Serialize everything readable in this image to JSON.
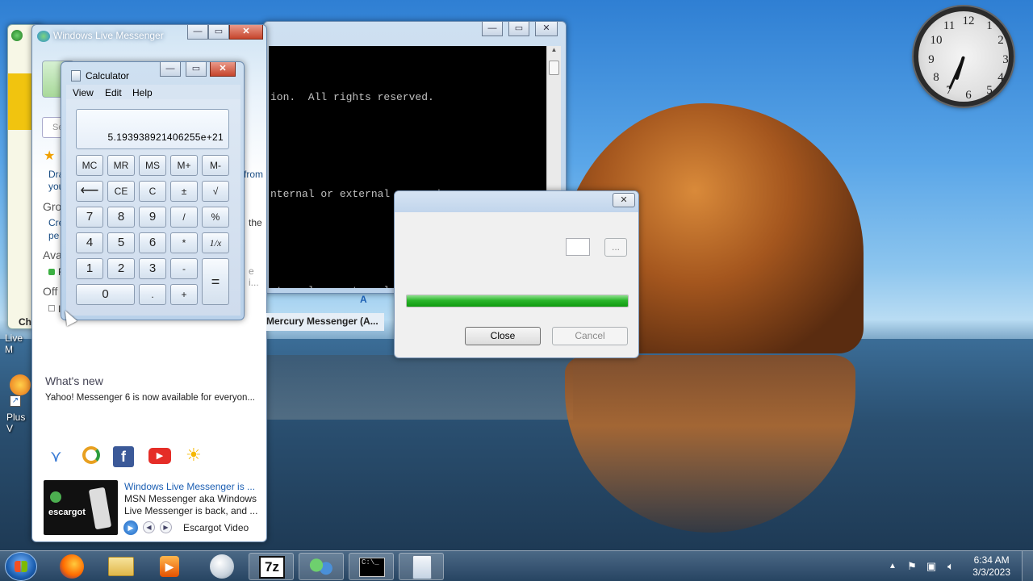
{
  "desktop": {
    "icon_labels": [
      "Live M",
      "Plus V"
    ]
  },
  "cmd": {
    "lines": [
      "ion.  All rights reserved.",
      "",
      "nternal or external command,",
      "",
      "nternal or external command,"
    ]
  },
  "dialog": {
    "close_label": "Close",
    "cancel_label": "Cancel",
    "browse_label": "...",
    "progress": 1.0,
    "progress_color": "#17a517"
  },
  "messenger": {
    "title": "Windows Live Messenger",
    "search_placeholder": "Se",
    "fragment_1": "Dra",
    "fragment_2": "you",
    "fragment_from": "from",
    "groups_label": "Gro",
    "fragment_cre": "Cre",
    "fragment_pe": "pe",
    "fragment_the": "the",
    "available_label": "Ava",
    "fragment_online": "F",
    "fragment_ellipsis": "e i...",
    "offline_label": "Off",
    "fragment_ch": "Ch",
    "fragment_i": "I",
    "mercury_label": "Mercury Messenger (A...",
    "whats_new_heading": "What's new",
    "whats_new_text": "Yahoo! Messenger 6 is now available for everyon...",
    "news_title": "Windows Live Messenger is ...",
    "news_body_1": "MSN Messenger aka Windows",
    "news_body_2": "Live Messenger is back, and ...",
    "news_thumb_label": "escargot",
    "video_label": "Escargot Video"
  },
  "calculator": {
    "title": "Calculator",
    "menu": [
      "View",
      "Edit",
      "Help"
    ],
    "display_value": "5.193938921406255e+21",
    "keys": [
      [
        "MC",
        "MR",
        "MS",
        "M+",
        "M-"
      ],
      [
        "⟵",
        "CE",
        "C",
        "±",
        "√"
      ],
      [
        "7",
        "8",
        "9",
        "/",
        "%"
      ],
      [
        "4",
        "5",
        "6",
        "*",
        "1/x"
      ],
      [
        "1",
        "2",
        "3",
        "-",
        "="
      ],
      [
        "0",
        ".",
        "+"
      ]
    ]
  },
  "clock": {
    "numbers": [
      "12",
      "1",
      "2",
      "3",
      "4",
      "5",
      "6",
      "7",
      "8",
      "9",
      "10",
      "11"
    ],
    "hour": 6,
    "minute": 34
  },
  "taskbar": {
    "time": "6:34 AM",
    "date": "3/3/2023",
    "apps": [
      "start-orb",
      "firefox",
      "file-explorer",
      "media-player",
      "messenger-orb",
      "7-zip",
      "windows-live-messenger",
      "command-prompt",
      "calculator"
    ],
    "sevenzip_label": "7z"
  }
}
